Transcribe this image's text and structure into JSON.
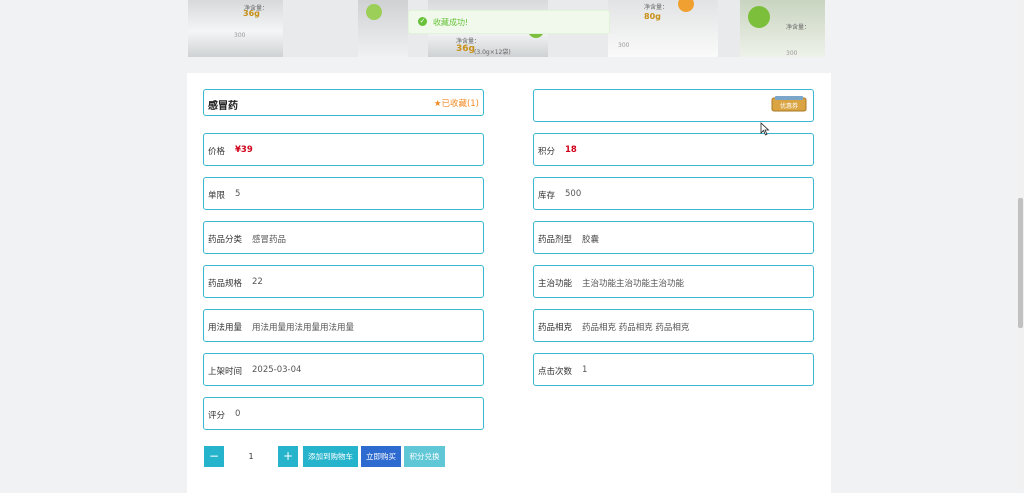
{
  "banner": {
    "net_label": "净含量：",
    "weight_small": "36g",
    "weight_main": "36g",
    "spec": "(3.0g×12袋)",
    "weight_right": "80g",
    "brand": "300"
  },
  "toast": {
    "message": "收藏成功!"
  },
  "product": {
    "name": "感冒药",
    "favorite_label": "已收藏(1)",
    "coupon_label": "优惠券",
    "fields": {
      "price": {
        "label": "价格",
        "value": "¥39"
      },
      "points": {
        "label": "积分",
        "value": "18"
      },
      "limit": {
        "label": "单限",
        "value": "5"
      },
      "stock": {
        "label": "库存",
        "value": "500"
      },
      "category": {
        "label": "药品分类",
        "value": "感冒药品"
      },
      "form": {
        "label": "药品剂型",
        "value": "胶囊"
      },
      "spec": {
        "label": "药品规格",
        "value": "22"
      },
      "function": {
        "label": "主治功能",
        "value": "主治功能主治功能主治功能"
      },
      "usage": {
        "label": "用法用量",
        "value": "用法用量用法用量用法用量"
      },
      "related": {
        "label": "药品相克",
        "value": "药品相克 药品相克 药品相克"
      },
      "listed": {
        "label": "上架时间",
        "value": "2025-03-04"
      },
      "clicks": {
        "label": "点击次数",
        "value": "1"
      },
      "rating": {
        "label": "评分",
        "value": "0"
      }
    }
  },
  "actions": {
    "minus": "−",
    "plus": "+",
    "quantity": "1",
    "add_cart": "添加到购物车",
    "buy_now": "立即购买",
    "redeem": "积分兑换"
  },
  "colors": {
    "border": "#39b8d0",
    "accent": "#25b4cc",
    "buy": "#2e6bd1",
    "redeem": "#5fc7d6",
    "price": "#d0021b",
    "favorite": "#f08a24",
    "toast_text": "#67c23a"
  },
  "icons": {
    "favorite": "star-icon",
    "toast": "check-circle-icon",
    "coupon": "ticket-icon",
    "cursor": "mouse-pointer-icon"
  }
}
